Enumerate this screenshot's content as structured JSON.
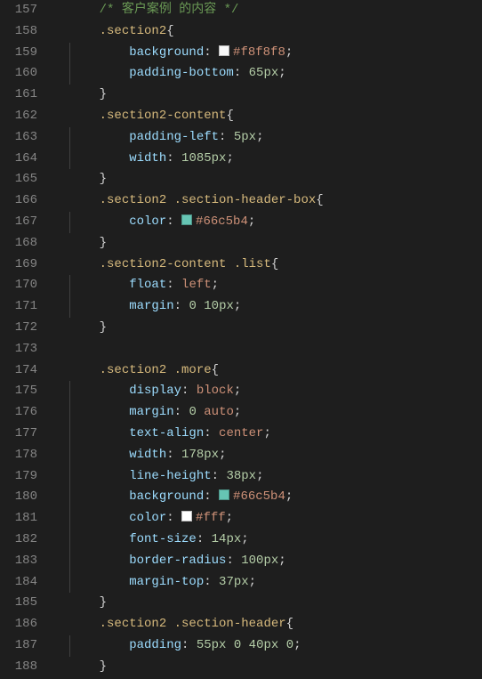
{
  "editor": {
    "startLine": 157,
    "lines": [
      {
        "indent": 1,
        "guides": [],
        "tokens": [
          {
            "cls": "tk-comment",
            "text": "/* 客户案例 的内容 */"
          }
        ]
      },
      {
        "indent": 1,
        "guides": [],
        "tokens": [
          {
            "cls": "tk-selector",
            "text": ".section2"
          },
          {
            "cls": "tk-brace",
            "text": "{"
          }
        ]
      },
      {
        "indent": 2,
        "guides": [
          1
        ],
        "tokens": [
          {
            "cls": "tk-prop",
            "text": "background"
          },
          {
            "cls": "tk-punct",
            "text": ": "
          },
          {
            "swatch": "#f8f8f8"
          },
          {
            "cls": "tk-value",
            "text": "#f8f8f8"
          },
          {
            "cls": "tk-punct",
            "text": ";"
          }
        ]
      },
      {
        "indent": 2,
        "guides": [
          1
        ],
        "tokens": [
          {
            "cls": "tk-prop",
            "text": "padding-bottom"
          },
          {
            "cls": "tk-punct",
            "text": ": "
          },
          {
            "cls": "tk-number",
            "text": "65px"
          },
          {
            "cls": "tk-punct",
            "text": ";"
          }
        ]
      },
      {
        "indent": 1,
        "guides": [],
        "tokens": [
          {
            "cls": "tk-brace",
            "text": "}"
          }
        ]
      },
      {
        "indent": 1,
        "guides": [],
        "tokens": [
          {
            "cls": "tk-selector",
            "text": ".section2-content"
          },
          {
            "cls": "tk-brace",
            "text": "{"
          }
        ]
      },
      {
        "indent": 2,
        "guides": [
          1
        ],
        "tokens": [
          {
            "cls": "tk-prop",
            "text": "padding-left"
          },
          {
            "cls": "tk-punct",
            "text": ": "
          },
          {
            "cls": "tk-number",
            "text": "5px"
          },
          {
            "cls": "tk-punct",
            "text": ";"
          }
        ]
      },
      {
        "indent": 2,
        "guides": [
          1
        ],
        "tokens": [
          {
            "cls": "tk-prop",
            "text": "width"
          },
          {
            "cls": "tk-punct",
            "text": ": "
          },
          {
            "cls": "tk-number",
            "text": "1085px"
          },
          {
            "cls": "tk-punct",
            "text": ";"
          }
        ]
      },
      {
        "indent": 1,
        "guides": [],
        "tokens": [
          {
            "cls": "tk-brace",
            "text": "}"
          }
        ]
      },
      {
        "indent": 1,
        "guides": [],
        "tokens": [
          {
            "cls": "tk-selector",
            "text": ".section2 .section-header-box"
          },
          {
            "cls": "tk-brace",
            "text": "{"
          }
        ]
      },
      {
        "indent": 2,
        "guides": [
          1
        ],
        "tokens": [
          {
            "cls": "tk-prop",
            "text": "color"
          },
          {
            "cls": "tk-punct",
            "text": ": "
          },
          {
            "swatch": "#66c5b4"
          },
          {
            "cls": "tk-value",
            "text": "#66c5b4"
          },
          {
            "cls": "tk-punct",
            "text": ";"
          }
        ]
      },
      {
        "indent": 1,
        "guides": [],
        "tokens": [
          {
            "cls": "tk-brace",
            "text": "}"
          }
        ]
      },
      {
        "indent": 1,
        "guides": [],
        "tokens": [
          {
            "cls": "tk-selector",
            "text": ".section2-content .list"
          },
          {
            "cls": "tk-brace",
            "text": "{"
          }
        ]
      },
      {
        "indent": 2,
        "guides": [
          1
        ],
        "tokens": [
          {
            "cls": "tk-prop",
            "text": "float"
          },
          {
            "cls": "tk-punct",
            "text": ": "
          },
          {
            "cls": "tk-value",
            "text": "left"
          },
          {
            "cls": "tk-punct",
            "text": ";"
          }
        ]
      },
      {
        "indent": 2,
        "guides": [
          1
        ],
        "tokens": [
          {
            "cls": "tk-prop",
            "text": "margin"
          },
          {
            "cls": "tk-punct",
            "text": ": "
          },
          {
            "cls": "tk-number",
            "text": "0"
          },
          {
            "cls": "tk-white",
            "text": " "
          },
          {
            "cls": "tk-number",
            "text": "10px"
          },
          {
            "cls": "tk-punct",
            "text": ";"
          }
        ]
      },
      {
        "indent": 1,
        "guides": [],
        "tokens": [
          {
            "cls": "tk-brace",
            "text": "}"
          }
        ]
      },
      {
        "indent": 0,
        "guides": [],
        "tokens": []
      },
      {
        "indent": 1,
        "guides": [],
        "tokens": [
          {
            "cls": "tk-selector",
            "text": ".section2 .more"
          },
          {
            "cls": "tk-brace",
            "text": "{"
          }
        ]
      },
      {
        "indent": 2,
        "guides": [
          1
        ],
        "tokens": [
          {
            "cls": "tk-prop",
            "text": "display"
          },
          {
            "cls": "tk-punct",
            "text": ": "
          },
          {
            "cls": "tk-value",
            "text": "block"
          },
          {
            "cls": "tk-punct",
            "text": ";"
          }
        ]
      },
      {
        "indent": 2,
        "guides": [
          1
        ],
        "tokens": [
          {
            "cls": "tk-prop",
            "text": "margin"
          },
          {
            "cls": "tk-punct",
            "text": ": "
          },
          {
            "cls": "tk-number",
            "text": "0"
          },
          {
            "cls": "tk-white",
            "text": " "
          },
          {
            "cls": "tk-value",
            "text": "auto"
          },
          {
            "cls": "tk-punct",
            "text": ";"
          }
        ]
      },
      {
        "indent": 2,
        "guides": [
          1
        ],
        "tokens": [
          {
            "cls": "tk-prop",
            "text": "text-align"
          },
          {
            "cls": "tk-punct",
            "text": ": "
          },
          {
            "cls": "tk-value",
            "text": "center"
          },
          {
            "cls": "tk-punct",
            "text": ";"
          }
        ]
      },
      {
        "indent": 2,
        "guides": [
          1
        ],
        "tokens": [
          {
            "cls": "tk-prop",
            "text": "width"
          },
          {
            "cls": "tk-punct",
            "text": ": "
          },
          {
            "cls": "tk-number",
            "text": "178px"
          },
          {
            "cls": "tk-punct",
            "text": ";"
          }
        ]
      },
      {
        "indent": 2,
        "guides": [
          1
        ],
        "tokens": [
          {
            "cls": "tk-prop",
            "text": "line-height"
          },
          {
            "cls": "tk-punct",
            "text": ": "
          },
          {
            "cls": "tk-number",
            "text": "38px"
          },
          {
            "cls": "tk-punct",
            "text": ";"
          }
        ]
      },
      {
        "indent": 2,
        "guides": [
          1
        ],
        "tokens": [
          {
            "cls": "tk-prop",
            "text": "background"
          },
          {
            "cls": "tk-punct",
            "text": ": "
          },
          {
            "swatch": "#66c5b4"
          },
          {
            "cls": "tk-value",
            "text": "#66c5b4"
          },
          {
            "cls": "tk-punct",
            "text": ";"
          }
        ]
      },
      {
        "indent": 2,
        "guides": [
          1
        ],
        "tokens": [
          {
            "cls": "tk-prop",
            "text": "color"
          },
          {
            "cls": "tk-punct",
            "text": ": "
          },
          {
            "swatch": "#ffffff"
          },
          {
            "cls": "tk-value",
            "text": "#fff"
          },
          {
            "cls": "tk-punct",
            "text": ";"
          }
        ]
      },
      {
        "indent": 2,
        "guides": [
          1
        ],
        "tokens": [
          {
            "cls": "tk-prop",
            "text": "font-size"
          },
          {
            "cls": "tk-punct",
            "text": ": "
          },
          {
            "cls": "tk-number",
            "text": "14px"
          },
          {
            "cls": "tk-punct",
            "text": ";"
          }
        ]
      },
      {
        "indent": 2,
        "guides": [
          1
        ],
        "tokens": [
          {
            "cls": "tk-prop",
            "text": "border-radius"
          },
          {
            "cls": "tk-punct",
            "text": ": "
          },
          {
            "cls": "tk-number",
            "text": "100px"
          },
          {
            "cls": "tk-punct",
            "text": ";"
          }
        ]
      },
      {
        "indent": 2,
        "guides": [
          1
        ],
        "tokens": [
          {
            "cls": "tk-prop",
            "text": "margin-top"
          },
          {
            "cls": "tk-punct",
            "text": ": "
          },
          {
            "cls": "tk-number",
            "text": "37px"
          },
          {
            "cls": "tk-punct",
            "text": ";"
          }
        ]
      },
      {
        "indent": 1,
        "guides": [],
        "tokens": [
          {
            "cls": "tk-brace",
            "text": "}"
          }
        ]
      },
      {
        "indent": 1,
        "guides": [],
        "tokens": [
          {
            "cls": "tk-selector",
            "text": ".section2 .section-header"
          },
          {
            "cls": "tk-brace",
            "text": "{"
          }
        ]
      },
      {
        "indent": 2,
        "guides": [
          1
        ],
        "tokens": [
          {
            "cls": "tk-prop",
            "text": "padding"
          },
          {
            "cls": "tk-punct",
            "text": ": "
          },
          {
            "cls": "tk-number",
            "text": "55px"
          },
          {
            "cls": "tk-white",
            "text": " "
          },
          {
            "cls": "tk-number",
            "text": "0"
          },
          {
            "cls": "tk-white",
            "text": " "
          },
          {
            "cls": "tk-number",
            "text": "40px"
          },
          {
            "cls": "tk-white",
            "text": " "
          },
          {
            "cls": "tk-number",
            "text": "0"
          },
          {
            "cls": "tk-punct",
            "text": ";"
          }
        ]
      },
      {
        "indent": 1,
        "guides": [],
        "tokens": [
          {
            "cls": "tk-brace",
            "text": "}"
          }
        ]
      }
    ]
  }
}
